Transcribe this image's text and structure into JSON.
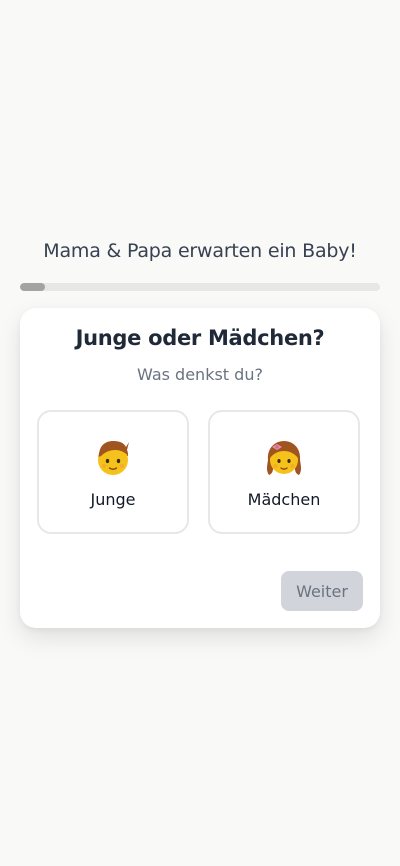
{
  "header": {
    "title": "Mama & Papa erwarten ein Baby!"
  },
  "progress": {
    "fraction": 0.07
  },
  "question": {
    "title": "Junge oder Mädchen?",
    "subtitle": "Was denkst du?",
    "options": [
      {
        "label": "Junge",
        "icon": "boy-emoji-icon"
      },
      {
        "label": "Mädchen",
        "icon": "girl-emoji-icon"
      }
    ],
    "next_label": "Weiter"
  },
  "colors": {
    "background": "#f9f9f8",
    "card": "#ffffff",
    "progress_track": "#e7e7e6",
    "progress_fill": "#a3a3a3",
    "button_disabled_bg": "#d1d5db",
    "button_disabled_text": "#6b7280"
  }
}
